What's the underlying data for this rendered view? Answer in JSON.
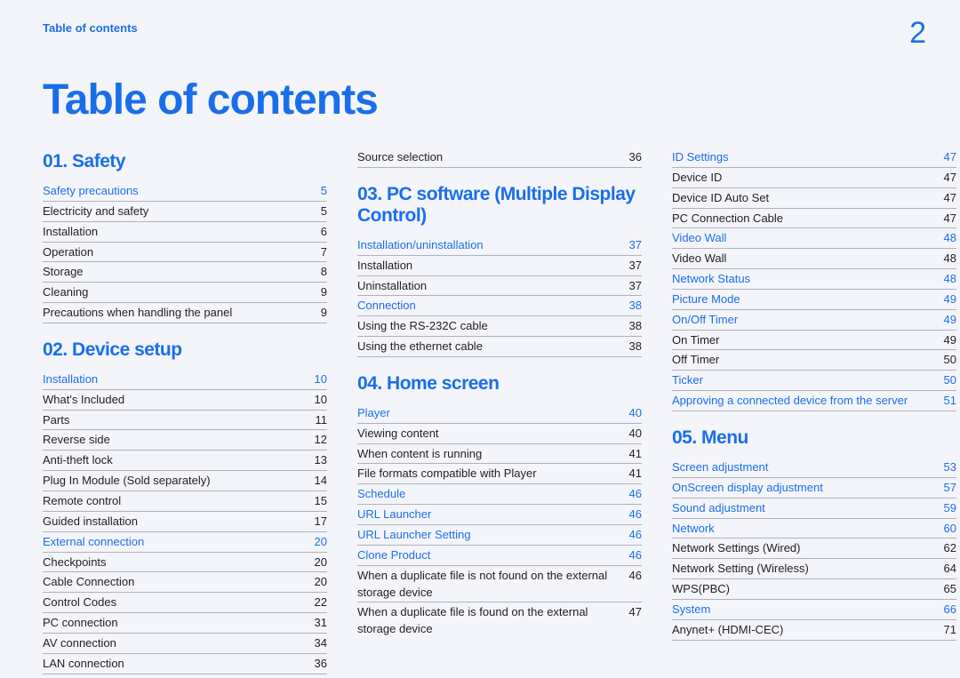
{
  "header": {
    "breadcrumb": "Table of contents",
    "pageNumber": "2"
  },
  "title": "Table of contents",
  "colors": {
    "accent": "#1a6eea"
  },
  "columns": [
    {
      "blocks": [
        {
          "type": "section",
          "text": "01. Safety"
        },
        {
          "type": "item",
          "heading": true,
          "label": "Safety precautions",
          "page": "5"
        },
        {
          "type": "item",
          "label": "Electricity and safety",
          "page": "5"
        },
        {
          "type": "item",
          "label": "Installation",
          "page": "6"
        },
        {
          "type": "item",
          "label": "Operation",
          "page": "7"
        },
        {
          "type": "item",
          "label": "Storage",
          "page": "8"
        },
        {
          "type": "item",
          "label": "Cleaning",
          "page": "9"
        },
        {
          "type": "item",
          "label": "Precautions when handling the panel",
          "page": "9"
        },
        {
          "type": "spacer"
        },
        {
          "type": "section",
          "text": "02. Device setup"
        },
        {
          "type": "item",
          "heading": true,
          "label": "Installation",
          "page": "10"
        },
        {
          "type": "item",
          "label": "What's Included",
          "page": "10"
        },
        {
          "type": "item",
          "label": "Parts",
          "page": "11"
        },
        {
          "type": "item",
          "label": "Reverse side",
          "page": "12"
        },
        {
          "type": "item",
          "label": "Anti-theft lock",
          "page": "13"
        },
        {
          "type": "item",
          "label": "Plug In Module (Sold separately)",
          "page": "14"
        },
        {
          "type": "item",
          "label": "Remote control",
          "page": "15"
        },
        {
          "type": "item",
          "label": "Guided installation",
          "page": "17"
        },
        {
          "type": "item",
          "heading": true,
          "label": "External connection",
          "page": "20"
        },
        {
          "type": "item",
          "label": "Checkpoints",
          "page": "20"
        },
        {
          "type": "item",
          "label": "Cable Connection",
          "page": "20"
        },
        {
          "type": "item",
          "label": "Control Codes",
          "page": "22"
        },
        {
          "type": "item",
          "label": "PC connection",
          "page": "31"
        },
        {
          "type": "item",
          "label": "AV connection",
          "page": "34"
        },
        {
          "type": "item",
          "label": "LAN connection",
          "page": "36"
        }
      ]
    },
    {
      "blocks": [
        {
          "type": "item",
          "label": "Source selection",
          "page": "36"
        },
        {
          "type": "spacer"
        },
        {
          "type": "section",
          "text": "03. PC software (Multiple Display Control)"
        },
        {
          "type": "item",
          "heading": true,
          "label": "Installation/uninstallation",
          "page": "37"
        },
        {
          "type": "item",
          "label": "Installation",
          "page": "37"
        },
        {
          "type": "item",
          "label": "Uninstallation",
          "page": "37"
        },
        {
          "type": "item",
          "heading": true,
          "label": "Connection",
          "page": "38"
        },
        {
          "type": "item",
          "label": "Using the RS-232C cable",
          "page": "38"
        },
        {
          "type": "item",
          "label": "Using the ethernet cable",
          "page": "38"
        },
        {
          "type": "spacer"
        },
        {
          "type": "section",
          "text": "04. Home screen"
        },
        {
          "type": "item",
          "heading": true,
          "label": "Player",
          "page": "40"
        },
        {
          "type": "item",
          "label": "Viewing content",
          "page": "40"
        },
        {
          "type": "item",
          "label": "When content is running",
          "page": "41"
        },
        {
          "type": "item",
          "label": "File formats compatible with Player",
          "page": "41"
        },
        {
          "type": "item",
          "heading": true,
          "label": "Schedule",
          "page": "46"
        },
        {
          "type": "item",
          "heading": true,
          "label": "URL Launcher",
          "page": "46"
        },
        {
          "type": "item",
          "heading": true,
          "label": "URL Launcher Setting",
          "page": "46"
        },
        {
          "type": "item",
          "heading": true,
          "label": "Clone Product",
          "page": "46"
        },
        {
          "type": "item",
          "label": "When a duplicate file is not found on the external storage device",
          "page": "46"
        },
        {
          "type": "item",
          "label": "When a duplicate file is found on the external storage device",
          "page": "47",
          "noborder": true
        }
      ]
    },
    {
      "blocks": [
        {
          "type": "item",
          "heading": true,
          "label": "ID Settings",
          "page": "47"
        },
        {
          "type": "item",
          "label": "Device ID",
          "page": "47"
        },
        {
          "type": "item",
          "label": "Device ID Auto Set",
          "page": "47"
        },
        {
          "type": "item",
          "label": "PC Connection Cable",
          "page": "47"
        },
        {
          "type": "item",
          "heading": true,
          "label": "Video Wall",
          "page": "48"
        },
        {
          "type": "item",
          "label": "Video Wall",
          "page": "48"
        },
        {
          "type": "item",
          "heading": true,
          "label": "Network Status",
          "page": "48"
        },
        {
          "type": "item",
          "heading": true,
          "label": "Picture Mode",
          "page": "49"
        },
        {
          "type": "item",
          "heading": true,
          "label": "On/Off Timer",
          "page": "49"
        },
        {
          "type": "item",
          "label": "On Timer",
          "page": "49"
        },
        {
          "type": "item",
          "label": "Off Timer",
          "page": "50"
        },
        {
          "type": "item",
          "heading": true,
          "label": "Ticker",
          "page": "50"
        },
        {
          "type": "item",
          "heading": true,
          "label": "Approving a connected device from the server",
          "page": "51"
        },
        {
          "type": "spacer"
        },
        {
          "type": "section",
          "text": "05. Menu"
        },
        {
          "type": "item",
          "heading": true,
          "label": "Screen adjustment",
          "page": "53"
        },
        {
          "type": "item",
          "heading": true,
          "label": "OnScreen display adjustment",
          "page": "57"
        },
        {
          "type": "item",
          "heading": true,
          "label": "Sound adjustment",
          "page": "59"
        },
        {
          "type": "item",
          "heading": true,
          "label": "Network",
          "page": "60"
        },
        {
          "type": "item",
          "label": "Network Settings (Wired)",
          "page": "62"
        },
        {
          "type": "item",
          "label": "Network Setting (Wireless)",
          "page": "64"
        },
        {
          "type": "item",
          "label": "WPS(PBC)",
          "page": "65"
        },
        {
          "type": "item",
          "heading": true,
          "label": "System",
          "page": "66"
        },
        {
          "type": "item",
          "label": "Anynet+ (HDMI-CEC)",
          "page": "71"
        }
      ]
    }
  ]
}
